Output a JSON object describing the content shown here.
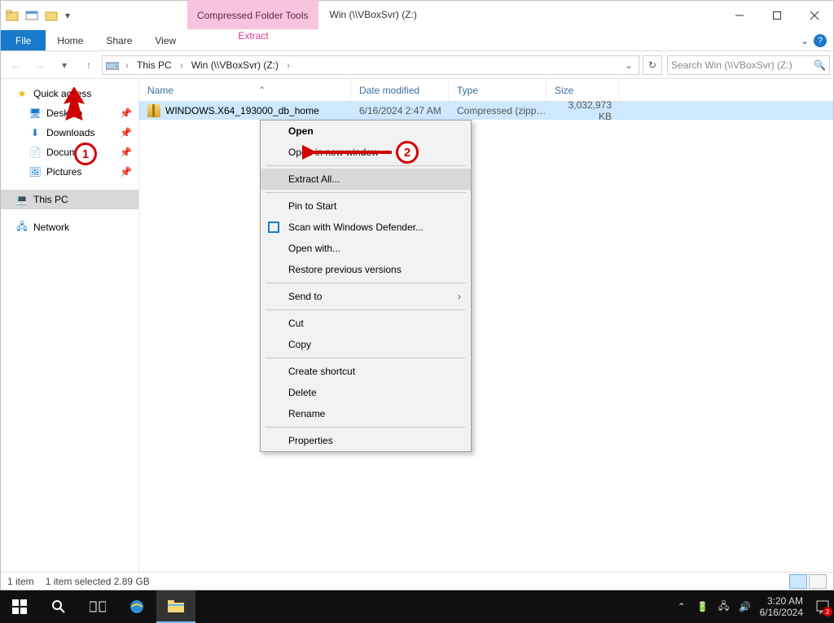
{
  "titlebar": {
    "tool_tab": "Compressed Folder Tools",
    "title": "Win (\\\\VBoxSvr) (Z:)"
  },
  "ribbon": {
    "file": "File",
    "home": "Home",
    "share": "Share",
    "view": "View",
    "extract": "Extract"
  },
  "breadcrumbs": {
    "root": "This PC",
    "loc": "Win (\\\\VBoxSvr) (Z:)"
  },
  "search": {
    "placeholder": "Search Win (\\\\VBoxSvr) (Z:)"
  },
  "nav": {
    "quick": "Quick access",
    "desktop": "Desktop",
    "downloads": "Downloads",
    "documents": "Documents",
    "pictures": "Pictures",
    "thispc": "This PC",
    "network": "Network"
  },
  "columns": {
    "name": "Name",
    "date": "Date modified",
    "type": "Type",
    "size": "Size"
  },
  "row": {
    "name": "WINDOWS.X64_193000_db_home",
    "date": "6/16/2024 2:47 AM",
    "type": "Compressed (zipp…",
    "size": "3,032,973 KB"
  },
  "ctx": {
    "open": "Open",
    "open_new": "Open in new window",
    "extract_all": "Extract All...",
    "pin_start": "Pin to Start",
    "defender": "Scan with Windows Defender...",
    "open_with": "Open with...",
    "restore": "Restore previous versions",
    "send_to": "Send to",
    "cut": "Cut",
    "copy": "Copy",
    "shortcut": "Create shortcut",
    "delete": "Delete",
    "rename": "Rename",
    "properties": "Properties"
  },
  "annotations": {
    "b1": "1",
    "b2": "2"
  },
  "status": {
    "items": "1 item",
    "selected": "1 item selected",
    "size": "2.89 GB"
  },
  "tray": {
    "time": "3:20 AM",
    "date": "6/16/2024",
    "notif_count": "2"
  }
}
